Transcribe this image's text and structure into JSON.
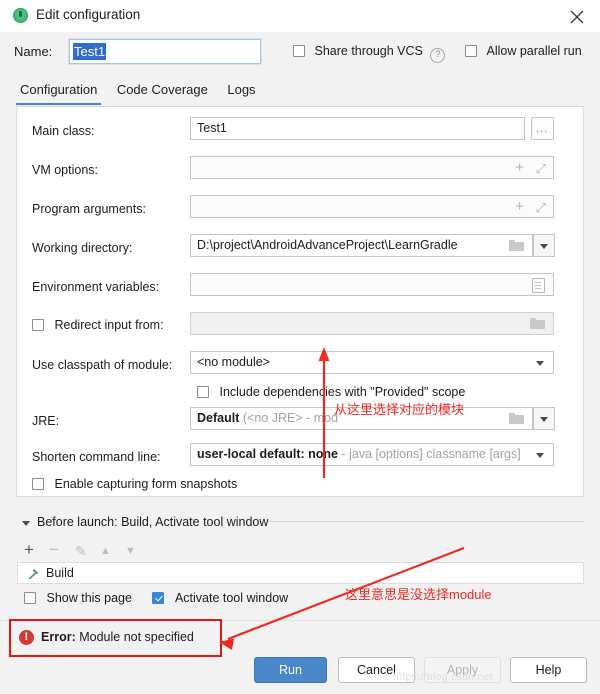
{
  "window": {
    "title": "Edit configuration",
    "icon": "run-configuration-icon",
    "close_label": "✕"
  },
  "name_row": {
    "label": "Name:",
    "value": "Test1",
    "placeholder": "",
    "share_label": "Share through VCS",
    "share_checked": false,
    "help_glyph": "?",
    "parallel_label": "Allow parallel run",
    "parallel_checked": false
  },
  "tabs": [
    {
      "label": "Configuration",
      "active": true
    },
    {
      "label": "Code Coverage",
      "active": false
    },
    {
      "label": "Logs",
      "active": false
    }
  ],
  "form": {
    "main_class": {
      "label": "Main class:",
      "value": "Test1",
      "browse_label": "...",
      "value_color": "#e0382f"
    },
    "vm_options": {
      "label": "VM options:",
      "value": ""
    },
    "program_arguments": {
      "label": "Program arguments:",
      "value": ""
    },
    "working_directory": {
      "label": "Working directory:",
      "value": "D:\\project\\AndroidAdvanceProject\\LearnGradle"
    },
    "environment_variables": {
      "label": "Environment variables:",
      "value": ""
    },
    "redirect_input": {
      "label": "Redirect input from:",
      "value": "",
      "checked": false
    },
    "use_classpath": {
      "label": "Use classpath of module:",
      "value": "<no module>"
    },
    "include_deps": {
      "label": "Include dependencies with \"Provided\" scope",
      "checked": false
    },
    "jre": {
      "label": "JRE:",
      "value": "Default",
      "value_dim": "(<no JRE> - mod"
    },
    "shorten_command_line": {
      "label": "Shorten command line:",
      "value": "user-local default: none",
      "value_dim": " - java [options] classname [args]"
    },
    "form_snapshots": {
      "label": "Enable capturing form snapshots",
      "checked": false
    }
  },
  "before_launch": {
    "title": "Before launch: Build, Activate tool window",
    "tools": [
      "+",
      "−",
      "✎",
      "▲",
      "▼"
    ],
    "items": [
      {
        "label": "Build",
        "icon": "hammer-icon"
      }
    ],
    "show_page_label": "Show this page",
    "show_page_checked": false,
    "activate_tool_label": "Activate tool window",
    "activate_tool_checked": true
  },
  "error": {
    "prefix": "Error:",
    "message": "Module not specified",
    "icon": "error-icon",
    "box_color": "#e8140f"
  },
  "buttons": {
    "run": "Run",
    "cancel": "Cancel",
    "apply": "Apply",
    "help": "Help",
    "run_color": "#4a87ca"
  },
  "annotations": {
    "module_hint": "从这里选择对应的模块",
    "error_hint": "这里意思是没选择module",
    "color": "#ee2b22"
  },
  "watermark": "https://blog.csdn.net"
}
